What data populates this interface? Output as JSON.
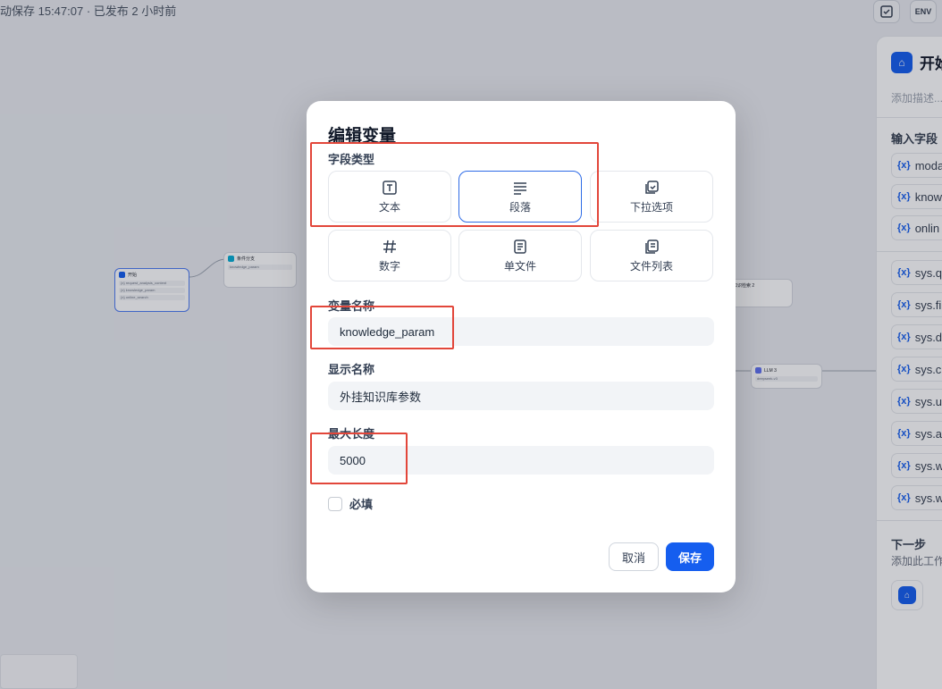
{
  "topbar": {
    "status": "动保存 15:47:07 · 已发布 2 小时前",
    "icon_env": "ENV"
  },
  "canvas": {
    "start_node": {
      "title": "开始",
      "rows": [
        "{x} request_analysis_content",
        "{x} knowledge_param",
        "{x} online_search"
      ]
    },
    "node2": {
      "title": "条件分支",
      "rows": [
        "knowledge_param"
      ]
    },
    "node3": {
      "title": "知识检索 2"
    },
    "node4": {
      "title": "LLM 3",
      "rows": [
        "deepseek-v3"
      ]
    }
  },
  "right_panel": {
    "title": "开始",
    "desc_placeholder": "添加描述...",
    "section_inputs": "输入字段",
    "fields": [
      "modal",
      "know",
      "onlin",
      "sys.q",
      "sys.fi",
      "sys.d",
      "sys.c",
      "sys.u",
      "sys.a",
      "sys.w",
      "sys.w"
    ],
    "field_prefix": "{x}",
    "next_title": "下一步",
    "next_desc": "添加此工作"
  },
  "modal": {
    "title": "编辑变量",
    "field_type_label": "字段类型",
    "types": [
      {
        "label": "文本",
        "icon": "text-icon"
      },
      {
        "label": "段落",
        "icon": "paragraph-icon"
      },
      {
        "label": "下拉选项",
        "icon": "select-icon"
      },
      {
        "label": "数字",
        "icon": "hash-icon"
      },
      {
        "label": "单文件",
        "icon": "file-icon"
      },
      {
        "label": "文件列表",
        "icon": "file-list-icon"
      }
    ],
    "selected_type": "段落",
    "var_name_label": "变量名称",
    "var_name_value": "knowledge_param",
    "display_name_label": "显示名称",
    "display_name_value": "外挂知识库参数",
    "max_length_label": "最大长度",
    "max_length_value": "5000",
    "required_label": "必填",
    "required_checked": false,
    "cancel_label": "取消",
    "save_label": "保存"
  },
  "colors": {
    "accent": "#155eef",
    "annotation_red": "#e2463a"
  }
}
